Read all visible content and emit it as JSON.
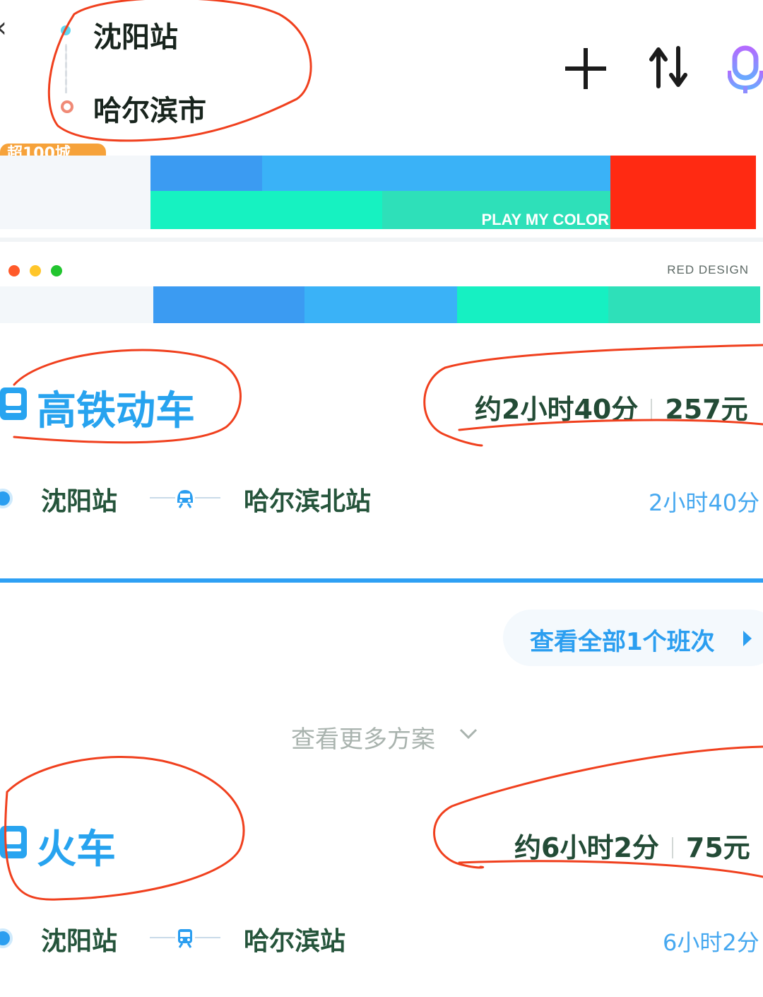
{
  "route": {
    "from": "沈阳站",
    "to": "哈尔滨市"
  },
  "header_icons": {
    "add": "plus-icon",
    "swap": "swap-icon",
    "voice": "microphone-icon"
  },
  "badge": {
    "text": "超100城"
  },
  "color_bars": {
    "bar1": {
      "text": "PLAY MY COLOR",
      "colors": [
        "#f4f7fa",
        "#3b9bf2",
        "#3ab2f7",
        "#16f2c1",
        "#2ee0b9",
        "#ff2a12"
      ]
    },
    "bar2": {
      "label": "RED DESIGN",
      "dots": [
        "#ff5a2a",
        "#ffc62a",
        "#22c52f"
      ],
      "colors": [
        "#f3f7fa",
        "#3b9bf2",
        "#3ab2f7",
        "#16f0c2",
        "#2ee0b9"
      ]
    }
  },
  "sections": {
    "high_speed": {
      "title": "高铁动车",
      "summary_time": "约2小时40分",
      "summary_price": "257元",
      "origin": "沈阳站",
      "destination": "哈尔滨北站",
      "duration": "2小时40分"
    },
    "view_all": "查看全部1个班次",
    "more_plans": "查看更多方案",
    "train": {
      "title": "火车",
      "summary_time": "约6小时2分",
      "summary_price": "75元",
      "origin": "沈阳站",
      "destination": "哈尔滨站",
      "duration": "6小时2分"
    }
  },
  "theme": {
    "accent": "#2ea0f4",
    "annotation": "#f0401e"
  }
}
